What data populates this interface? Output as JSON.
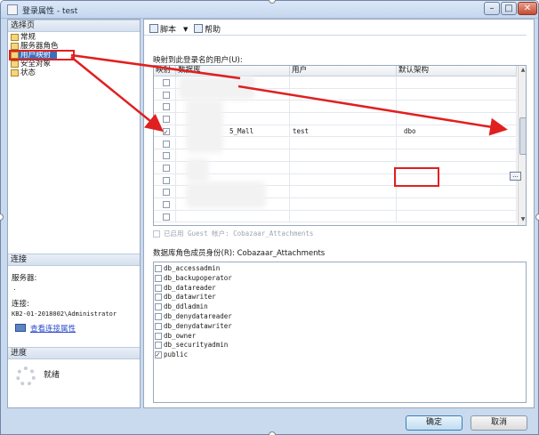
{
  "window": {
    "title": "登录属性 - test",
    "min": "–",
    "max": "□",
    "close": "✕"
  },
  "left": {
    "select_page_header": "选择页",
    "pages": [
      "常规",
      "服务器角色",
      "用户映射",
      "安全对象",
      "状态"
    ],
    "selected_index": 2,
    "connection_header": "连接",
    "server_label": "服务器:",
    "server_value": ".",
    "connect_label": "连接:",
    "connect_value": "KB2-01-2018002\\Administrator",
    "view_conn_props": "查看连接属性",
    "progress_header": "进度",
    "progress_status": "就绪"
  },
  "toolbar": {
    "script": "脚本",
    "dropdown": "▼",
    "help": "帮助"
  },
  "mapping": {
    "label": "映射到此登录名的用户(U):",
    "columns": [
      "映射",
      "数据库",
      "用户",
      "默认架构"
    ],
    "rows": [
      {
        "mapped": false,
        "db": "",
        "user": "",
        "schema": ""
      },
      {
        "mapped": false,
        "db": "",
        "user": "",
        "schema": ""
      },
      {
        "mapped": false,
        "db": "",
        "user": "",
        "schema": ""
      },
      {
        "mapped": false,
        "db": "",
        "user": "",
        "schema": ""
      },
      {
        "mapped": true,
        "db": "5_Mall",
        "user": "test",
        "schema": "dbo"
      },
      {
        "mapped": false,
        "db": "",
        "user": "",
        "schema": ""
      },
      {
        "mapped": false,
        "db": "",
        "user": "",
        "schema": ""
      },
      {
        "mapped": false,
        "db": "",
        "user": "",
        "schema": ""
      },
      {
        "mapped": false,
        "db": "",
        "user": "",
        "schema": ""
      },
      {
        "mapped": false,
        "db": "",
        "user": "",
        "schema": ""
      },
      {
        "mapped": false,
        "db": "",
        "user": "",
        "schema": ""
      },
      {
        "mapped": false,
        "db": "",
        "user": "",
        "schema": ""
      }
    ],
    "ellipsis": "..."
  },
  "guest": "已启用 Guest 帐户: Cobazaar_Attachments",
  "roles": {
    "label": "数据库角色成员身份(R): Cobazaar_Attachments",
    "items": [
      {
        "name": "db_accessadmin",
        "checked": false
      },
      {
        "name": "db_backupoperator",
        "checked": false
      },
      {
        "name": "db_datareader",
        "checked": false
      },
      {
        "name": "db_datawriter",
        "checked": false
      },
      {
        "name": "db_ddladmin",
        "checked": false
      },
      {
        "name": "db_denydatareader",
        "checked": false
      },
      {
        "name": "db_denydatawriter",
        "checked": false
      },
      {
        "name": "db_owner",
        "checked": false
      },
      {
        "name": "db_securityadmin",
        "checked": false
      },
      {
        "name": "public",
        "checked": true
      }
    ]
  },
  "buttons": {
    "ok": "确定",
    "cancel": "取消"
  },
  "colors": {
    "annotation": "#e02020",
    "selection": "#3d6fb8"
  }
}
